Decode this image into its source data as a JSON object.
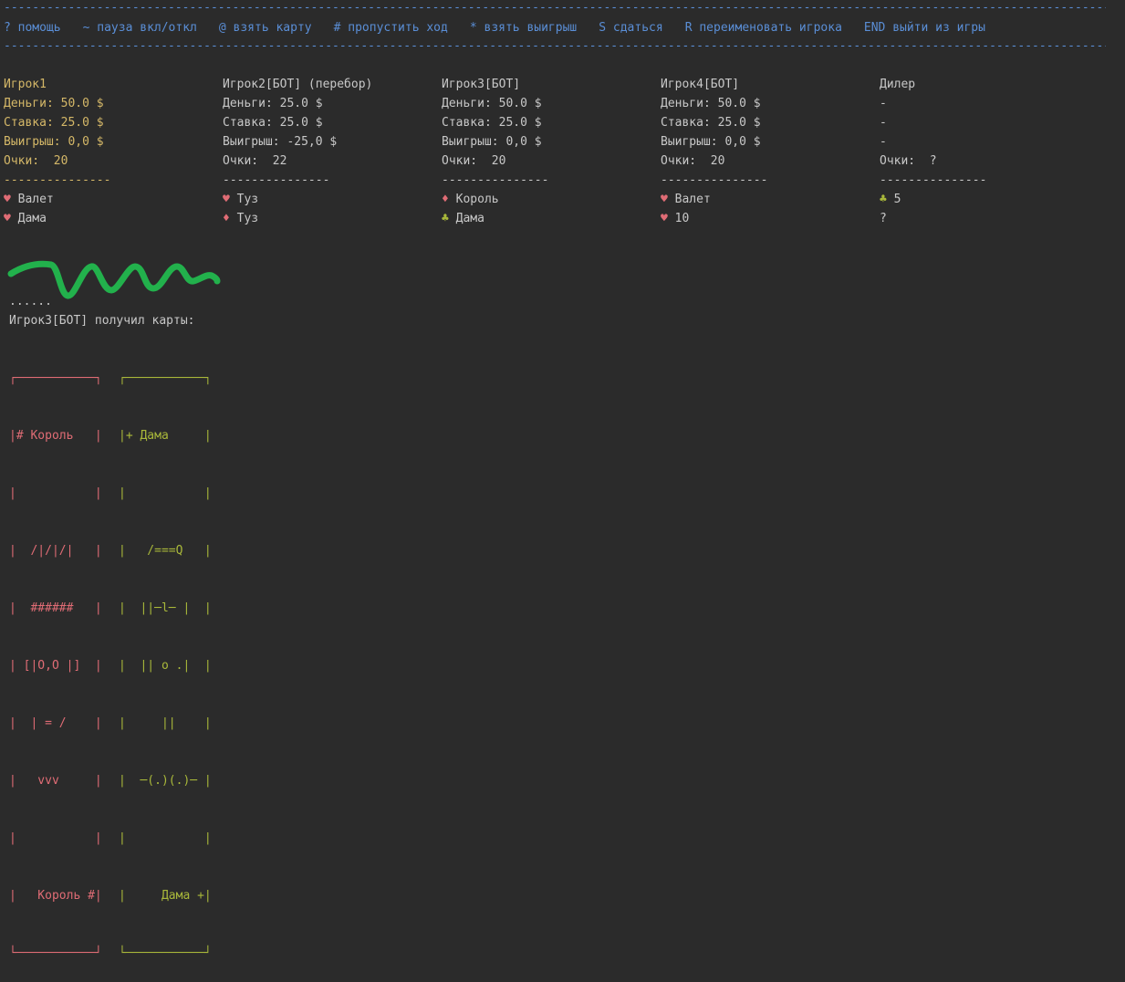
{
  "separator": "-------------------------------------------------------------------------------------------------------------------------------------------------------------------------------------------------------------------",
  "menu": [
    "? помощь",
    "~ пауза вкл/откл",
    "@ взять карту",
    "# пропустить ход",
    "* взять выигрыш",
    "S сдаться",
    "R переименовать игрока",
    "END выйти из игры"
  ],
  "players": [
    {
      "name": "Игрок1",
      "money": "Деньги: 50.0 $",
      "bet": "Ставка: 25.0 $",
      "win": "Выигрыш: 0,0 $",
      "points": "Очки:  20",
      "divider": "---------------",
      "cards": [
        {
          "suit": "♥",
          "suit_color": "red",
          "name": "Валет"
        },
        {
          "suit": "♥",
          "suit_color": "red",
          "name": "Дама"
        }
      ]
    },
    {
      "name": "Игрок2[БОТ] (перебор)",
      "money": "Деньги: 25.0 $",
      "bet": "Ставка: 25.0 $",
      "win": "Выигрыш: -25,0 $",
      "points": "Очки:  22",
      "divider": "---------------",
      "cards": [
        {
          "suit": "♥",
          "suit_color": "red",
          "name": "Туз"
        },
        {
          "suit": "♦",
          "suit_color": "red",
          "name": "Туз"
        }
      ]
    },
    {
      "name": "Игрок3[БОТ]",
      "money": "Деньги: 50.0 $",
      "bet": "Ставка: 25.0 $",
      "win": "Выигрыш: 0,0 $",
      "points": "Очки:  20",
      "divider": "---------------",
      "cards": [
        {
          "suit": "♦",
          "suit_color": "red",
          "name": "Король"
        },
        {
          "suit": "♣",
          "suit_color": "green",
          "name": "Дама"
        }
      ]
    },
    {
      "name": "Игрок4[БОТ]",
      "money": "Деньги: 50.0 $",
      "bet": "Ставка: 25.0 $",
      "win": "Выигрыш: 0,0 $",
      "points": "Очки:  20",
      "divider": "---------------",
      "cards": [
        {
          "suit": "♥",
          "suit_color": "red",
          "name": "Валет"
        },
        {
          "suit": "♥",
          "suit_color": "red",
          "name": "10"
        }
      ]
    },
    {
      "name": "Дилер",
      "money": "-",
      "bet": "-",
      "win": "-",
      "points": "Очки:  ?",
      "divider": "---------------",
      "cards": [
        {
          "suit": "♣",
          "suit_color": "green",
          "name": "5"
        },
        {
          "suit": "?",
          "suit_color": "plain",
          "name": ""
        }
      ]
    }
  ],
  "log": {
    "dots": "......",
    "message": "Игрок3[БОТ] получил карты:"
  },
  "card_art": {
    "king": [
      "┌───────────┐",
      "|# Король   |",
      "|           |",
      "|  /|/|/|   |",
      "|  ######   |",
      "| [|O,O |]  |",
      "|  | = /    |",
      "|   vvv     |",
      "|           |",
      "|   Король #|",
      "└───────────┘"
    ],
    "queen": [
      "┌───────────┐",
      "|+ Дама     |",
      "|           |",
      "|   /===Q   |",
      "|  ||─l─ |  |",
      "|  || o .|  |",
      "|     ||    |",
      "|  ─(.)(.)─ |",
      "|           |",
      "|     Дама +|",
      "└───────────┘"
    ]
  },
  "colors": {
    "background": "#2b2b2b",
    "menu_blue": "#5a8ed6",
    "active_player_yellow": "#d5b868",
    "red_suit": "#e06c75",
    "green_suit": "#a9b83a",
    "scribble_green": "#22b14c"
  }
}
